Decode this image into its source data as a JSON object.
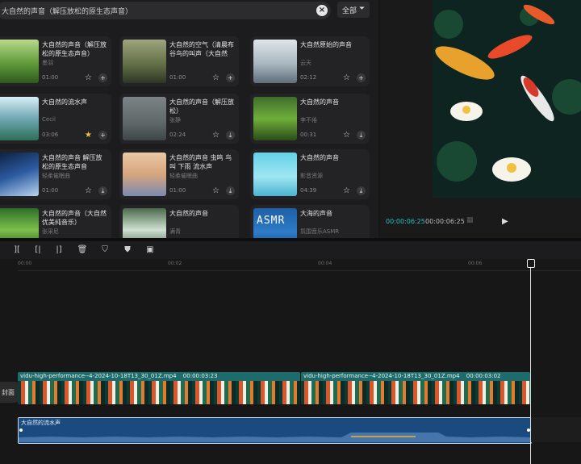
{
  "library": {
    "search_query": "大自然的声音（解压放松的原生态声音）",
    "filter_label": "全部",
    "cards": [
      {
        "title": "大自然的声音（解压放松的原生态声音）",
        "subtitle": "墨羽",
        "duration": "01:00",
        "starred": false,
        "action": "add"
      },
      {
        "title": "大自然的空气（清晨布谷鸟的叫声（大自然的...",
        "subtitle": "",
        "duration": "01:00",
        "starred": false,
        "action": "add"
      },
      {
        "title": "大自然原始的声音",
        "subtitle": "云天",
        "duration": "02:12",
        "starred": false,
        "action": "add"
      },
      {
        "title": "大自然的流水声",
        "subtitle": "Cecil",
        "duration": "03:06",
        "starred": true,
        "action": "add"
      },
      {
        "title": "大自然的声音（解压放松）",
        "subtitle": "张静",
        "duration": "02:24",
        "starred": false,
        "action": "download"
      },
      {
        "title": "大自然的声音",
        "subtitle": "李不倦",
        "duration": "00:31",
        "starred": false,
        "action": "download"
      },
      {
        "title": "大自然的声音 解压放松的原生态声音",
        "subtitle": "轻柔催眠曲",
        "duration": "01:00",
        "starred": false,
        "action": "download"
      },
      {
        "title": "大自然的声音 虫鸣 鸟叫 下雨 流水声",
        "subtitle": "轻柔催眠曲",
        "duration": "01:00",
        "starred": false,
        "action": "download"
      },
      {
        "title": "大自然的声音",
        "subtitle": "影音资源",
        "duration": "04:39",
        "starred": false,
        "action": "download"
      },
      {
        "title": "大自然的声音（大自然优美纯音乐）",
        "subtitle": "张采尼",
        "duration": "",
        "starred": false,
        "action": ""
      },
      {
        "title": "大自然的声音",
        "subtitle": "满青",
        "duration": "",
        "starred": false,
        "action": ""
      },
      {
        "title": "大海的声音",
        "subtitle": "氛围音乐ASMR",
        "duration": "",
        "starred": false,
        "action": ""
      }
    ],
    "asmr_thumb_label": "ASMR"
  },
  "player": {
    "current_time": "00:00:06:25",
    "total_time": "00:00:06:25"
  },
  "timeline": {
    "ruler_labels": [
      "00:00",
      "00:02",
      "00:04",
      "00:06"
    ],
    "cover_label": "封面",
    "clips": [
      {
        "name": "vidu-high-performance--4-2024-10-18T13_30_01Z.mp4",
        "duration": "00:00:03:23"
      },
      {
        "name": "vidu-high-performance--4-2024-10-18T13_30_01Z.mp4",
        "duration": "00:00:03:02"
      }
    ],
    "audio_clip_name": "大自然的流水声"
  },
  "colors": {
    "accent": "#29c2c2",
    "video_clip": "#1d6b6b",
    "audio_clip": "#1b4a7f"
  }
}
